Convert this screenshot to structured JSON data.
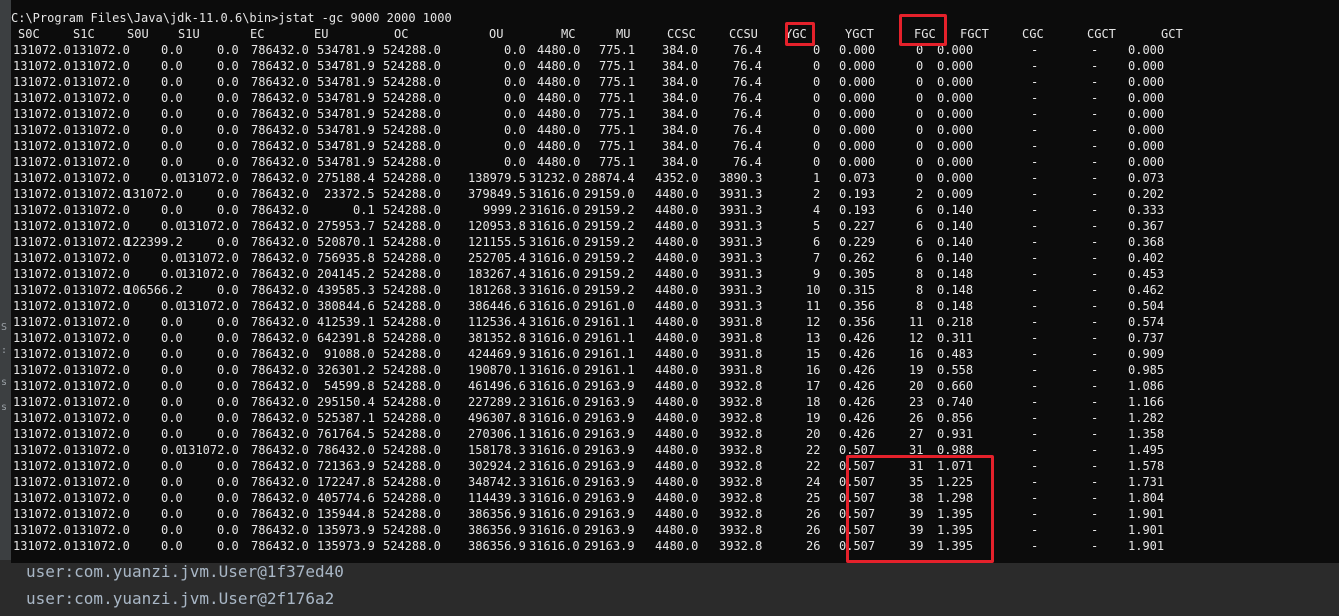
{
  "console": {
    "command": "C:\\Program Files\\Java\\jdk-11.0.6\\bin>jstat -gc 9000 2000 1000",
    "headers": [
      "S0C",
      "S1C",
      "S0U",
      "S1U",
      "EC",
      "EU",
      "OC",
      "OU",
      "MC",
      "MU",
      "CCSC",
      "CCSU",
      "YGC",
      "YGCT",
      "FGC",
      "FGCT",
      "CGC",
      "CGCT",
      "GCT"
    ],
    "rows": [
      [
        "131072.0",
        "131072.0",
        "0.0",
        "0.0",
        "786432.0",
        "534781.9",
        "524288.0",
        "0.0",
        "4480.0",
        "775.1",
        "384.0",
        "76.4",
        "0",
        "0.000",
        "0",
        "0.000",
        "-",
        "-",
        "0.000"
      ],
      [
        "131072.0",
        "131072.0",
        "0.0",
        "0.0",
        "786432.0",
        "534781.9",
        "524288.0",
        "0.0",
        "4480.0",
        "775.1",
        "384.0",
        "76.4",
        "0",
        "0.000",
        "0",
        "0.000",
        "-",
        "-",
        "0.000"
      ],
      [
        "131072.0",
        "131072.0",
        "0.0",
        "0.0",
        "786432.0",
        "534781.9",
        "524288.0",
        "0.0",
        "4480.0",
        "775.1",
        "384.0",
        "76.4",
        "0",
        "0.000",
        "0",
        "0.000",
        "-",
        "-",
        "0.000"
      ],
      [
        "131072.0",
        "131072.0",
        "0.0",
        "0.0",
        "786432.0",
        "534781.9",
        "524288.0",
        "0.0",
        "4480.0",
        "775.1",
        "384.0",
        "76.4",
        "0",
        "0.000",
        "0",
        "0.000",
        "-",
        "-",
        "0.000"
      ],
      [
        "131072.0",
        "131072.0",
        "0.0",
        "0.0",
        "786432.0",
        "534781.9",
        "524288.0",
        "0.0",
        "4480.0",
        "775.1",
        "384.0",
        "76.4",
        "0",
        "0.000",
        "0",
        "0.000",
        "-",
        "-",
        "0.000"
      ],
      [
        "131072.0",
        "131072.0",
        "0.0",
        "0.0",
        "786432.0",
        "534781.9",
        "524288.0",
        "0.0",
        "4480.0",
        "775.1",
        "384.0",
        "76.4",
        "0",
        "0.000",
        "0",
        "0.000",
        "-",
        "-",
        "0.000"
      ],
      [
        "131072.0",
        "131072.0",
        "0.0",
        "0.0",
        "786432.0",
        "534781.9",
        "524288.0",
        "0.0",
        "4480.0",
        "775.1",
        "384.0",
        "76.4",
        "0",
        "0.000",
        "0",
        "0.000",
        "-",
        "-",
        "0.000"
      ],
      [
        "131072.0",
        "131072.0",
        "0.0",
        "0.0",
        "786432.0",
        "534781.9",
        "524288.0",
        "0.0",
        "4480.0",
        "775.1",
        "384.0",
        "76.4",
        "0",
        "0.000",
        "0",
        "0.000",
        "-",
        "-",
        "0.000"
      ],
      [
        "131072.0",
        "131072.0",
        "0.0",
        "131072.0",
        "786432.0",
        "275188.4",
        "524288.0",
        "138979.5",
        "31232.0",
        "28874.4",
        "4352.0",
        "3890.3",
        "1",
        "0.073",
        "0",
        "0.000",
        "-",
        "-",
        "0.073"
      ],
      [
        "131072.0",
        "131072.0",
        "131072.0",
        "0.0",
        "786432.0",
        "23372.5",
        "524288.0",
        "379849.5",
        "31616.0",
        "29159.0",
        "4480.0",
        "3931.3",
        "2",
        "0.193",
        "2",
        "0.009",
        "-",
        "-",
        "0.202"
      ],
      [
        "131072.0",
        "131072.0",
        "0.0",
        "0.0",
        "786432.0",
        "0.1",
        "524288.0",
        "9999.2",
        "31616.0",
        "29159.2",
        "4480.0",
        "3931.3",
        "4",
        "0.193",
        "6",
        "0.140",
        "-",
        "-",
        "0.333"
      ],
      [
        "131072.0",
        "131072.0",
        "0.0",
        "131072.0",
        "786432.0",
        "275953.7",
        "524288.0",
        "120953.8",
        "31616.0",
        "29159.2",
        "4480.0",
        "3931.3",
        "5",
        "0.227",
        "6",
        "0.140",
        "-",
        "-",
        "0.367"
      ],
      [
        "131072.0",
        "131072.0",
        "122399.2",
        "0.0",
        "786432.0",
        "520870.1",
        "524288.0",
        "121155.5",
        "31616.0",
        "29159.2",
        "4480.0",
        "3931.3",
        "6",
        "0.229",
        "6",
        "0.140",
        "-",
        "-",
        "0.368"
      ],
      [
        "131072.0",
        "131072.0",
        "0.0",
        "131072.0",
        "786432.0",
        "756935.8",
        "524288.0",
        "252705.4",
        "31616.0",
        "29159.2",
        "4480.0",
        "3931.3",
        "7",
        "0.262",
        "6",
        "0.140",
        "-",
        "-",
        "0.402"
      ],
      [
        "131072.0",
        "131072.0",
        "0.0",
        "131072.0",
        "786432.0",
        "204145.2",
        "524288.0",
        "183267.4",
        "31616.0",
        "29159.2",
        "4480.0",
        "3931.3",
        "9",
        "0.305",
        "8",
        "0.148",
        "-",
        "-",
        "0.453"
      ],
      [
        "131072.0",
        "131072.0",
        "106566.2",
        "0.0",
        "786432.0",
        "439585.3",
        "524288.0",
        "181268.3",
        "31616.0",
        "29159.2",
        "4480.0",
        "3931.3",
        "10",
        "0.315",
        "8",
        "0.148",
        "-",
        "-",
        "0.462"
      ],
      [
        "131072.0",
        "131072.0",
        "0.0",
        "131072.0",
        "786432.0",
        "380844.6",
        "524288.0",
        "386446.6",
        "31616.0",
        "29161.0",
        "4480.0",
        "3931.3",
        "11",
        "0.356",
        "8",
        "0.148",
        "-",
        "-",
        "0.504"
      ],
      [
        "131072.0",
        "131072.0",
        "0.0",
        "0.0",
        "786432.0",
        "412539.1",
        "524288.0",
        "112536.4",
        "31616.0",
        "29161.1",
        "4480.0",
        "3931.8",
        "12",
        "0.356",
        "11",
        "0.218",
        "-",
        "-",
        "0.574"
      ],
      [
        "131072.0",
        "131072.0",
        "0.0",
        "0.0",
        "786432.0",
        "642391.8",
        "524288.0",
        "381352.8",
        "31616.0",
        "29161.1",
        "4480.0",
        "3931.8",
        "13",
        "0.426",
        "12",
        "0.311",
        "-",
        "-",
        "0.737"
      ],
      [
        "131072.0",
        "131072.0",
        "0.0",
        "0.0",
        "786432.0",
        "91088.0",
        "524288.0",
        "424469.9",
        "31616.0",
        "29161.1",
        "4480.0",
        "3931.8",
        "15",
        "0.426",
        "16",
        "0.483",
        "-",
        "-",
        "0.909"
      ],
      [
        "131072.0",
        "131072.0",
        "0.0",
        "0.0",
        "786432.0",
        "326301.2",
        "524288.0",
        "190870.1",
        "31616.0",
        "29161.1",
        "4480.0",
        "3931.8",
        "16",
        "0.426",
        "19",
        "0.558",
        "-",
        "-",
        "0.985"
      ],
      [
        "131072.0",
        "131072.0",
        "0.0",
        "0.0",
        "786432.0",
        "54599.8",
        "524288.0",
        "461496.6",
        "31616.0",
        "29163.9",
        "4480.0",
        "3932.8",
        "17",
        "0.426",
        "20",
        "0.660",
        "-",
        "-",
        "1.086"
      ],
      [
        "131072.0",
        "131072.0",
        "0.0",
        "0.0",
        "786432.0",
        "295150.4",
        "524288.0",
        "227289.2",
        "31616.0",
        "29163.9",
        "4480.0",
        "3932.8",
        "18",
        "0.426",
        "23",
        "0.740",
        "-",
        "-",
        "1.166"
      ],
      [
        "131072.0",
        "131072.0",
        "0.0",
        "0.0",
        "786432.0",
        "525387.1",
        "524288.0",
        "496307.8",
        "31616.0",
        "29163.9",
        "4480.0",
        "3932.8",
        "19",
        "0.426",
        "26",
        "0.856",
        "-",
        "-",
        "1.282"
      ],
      [
        "131072.0",
        "131072.0",
        "0.0",
        "0.0",
        "786432.0",
        "761764.5",
        "524288.0",
        "270306.1",
        "31616.0",
        "29163.9",
        "4480.0",
        "3932.8",
        "20",
        "0.426",
        "27",
        "0.931",
        "-",
        "-",
        "1.358"
      ],
      [
        "131072.0",
        "131072.0",
        "0.0",
        "131072.0",
        "786432.0",
        "786432.0",
        "524288.0",
        "158178.3",
        "31616.0",
        "29163.9",
        "4480.0",
        "3932.8",
        "22",
        "0.507",
        "31",
        "0.988",
        "-",
        "-",
        "1.495"
      ],
      [
        "131072.0",
        "131072.0",
        "0.0",
        "0.0",
        "786432.0",
        "721363.9",
        "524288.0",
        "302924.2",
        "31616.0",
        "29163.9",
        "4480.0",
        "3932.8",
        "22",
        "0.507",
        "31",
        "1.071",
        "-",
        "-",
        "1.578"
      ],
      [
        "131072.0",
        "131072.0",
        "0.0",
        "0.0",
        "786432.0",
        "172247.8",
        "524288.0",
        "348742.3",
        "31616.0",
        "29163.9",
        "4480.0",
        "3932.8",
        "24",
        "0.507",
        "35",
        "1.225",
        "-",
        "-",
        "1.731"
      ],
      [
        "131072.0",
        "131072.0",
        "0.0",
        "0.0",
        "786432.0",
        "405774.6",
        "524288.0",
        "114439.3",
        "31616.0",
        "29163.9",
        "4480.0",
        "3932.8",
        "25",
        "0.507",
        "38",
        "1.298",
        "-",
        "-",
        "1.804"
      ],
      [
        "131072.0",
        "131072.0",
        "0.0",
        "0.0",
        "786432.0",
        "135944.8",
        "524288.0",
        "386356.9",
        "31616.0",
        "29163.9",
        "4480.0",
        "3932.8",
        "26",
        "0.507",
        "39",
        "1.395",
        "-",
        "-",
        "1.901"
      ],
      [
        "131072.0",
        "131072.0",
        "0.0",
        "0.0",
        "786432.0",
        "135973.9",
        "524288.0",
        "386356.9",
        "31616.0",
        "29163.9",
        "4480.0",
        "3932.8",
        "26",
        "0.507",
        "39",
        "1.395",
        "-",
        "-",
        "1.901"
      ],
      [
        "131072.0",
        "131072.0",
        "0.0",
        "0.0",
        "786432.0",
        "135973.9",
        "524288.0",
        "386356.9",
        "31616.0",
        "29163.9",
        "4480.0",
        "3932.8",
        "26",
        "0.507",
        "39",
        "1.395",
        "-",
        "-",
        "1.901"
      ]
    ]
  },
  "ide_output": {
    "lines": [
      "user:com.yuanzi.jvm.User@1f37ed40",
      "user:com.yuanzi.jvm.User@2f176a2"
    ]
  },
  "colors": {
    "highlight": "#e5212b",
    "console_bg": "#0c0c0c",
    "console_text": "#e6e6e6",
    "ide_text": "#a9b7c6"
  }
}
